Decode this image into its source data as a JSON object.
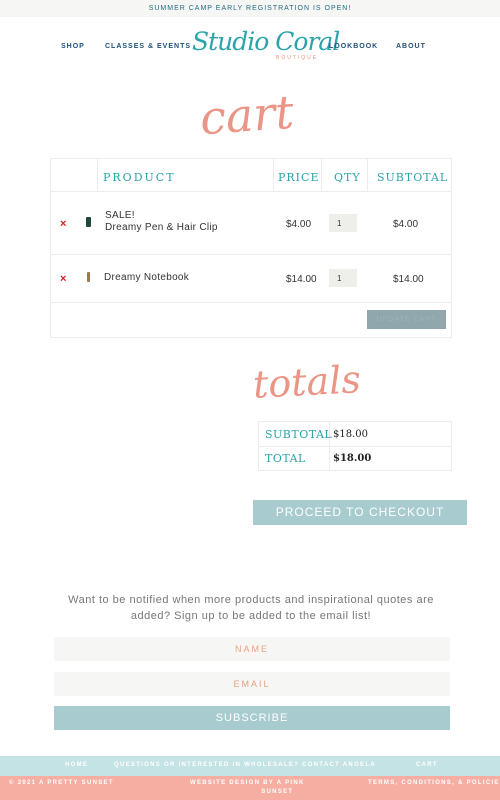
{
  "announcement": "SUMMER CAMP EARLY REGISTRATION IS OPEN!",
  "nav": {
    "shop": "SHOP",
    "classes": "CLASSES & EVENTS",
    "lookbook": "LOOKBOOK",
    "about": "ABOUT"
  },
  "logo": {
    "script": "Studio Coral",
    "subtitle": "BOUTIQUE"
  },
  "cart": {
    "title": "cart",
    "headers": {
      "product": "PRODUCT",
      "price": "PRICE",
      "qty": "QTY",
      "subtotal": "SUBTOTAL"
    },
    "items": [
      {
        "remove": "×",
        "name_line1": "SALE!",
        "name_line2": "Dreamy Pen & Hair Clip",
        "price": "$4.00",
        "qty": "1",
        "subtotal": "$4.00"
      },
      {
        "remove": "×",
        "name_line1": "Dreamy Notebook",
        "price": "$14.00",
        "qty": "1",
        "subtotal": "$14.00"
      }
    ],
    "update_label": "UPDATE CART"
  },
  "totals": {
    "title": "totals",
    "subtotal_label": "SUBTOTAL",
    "subtotal_value": "$18.00",
    "total_label": "TOTAL",
    "total_value": "$18.00",
    "checkout_label": "PROCEED TO CHECKOUT"
  },
  "signup": {
    "text": "Want to be notified when more products and inspirational quotes are added? Sign up to be added to the email list!",
    "name_placeholder": "NAME",
    "email_placeholder": "EMAIL",
    "subscribe_label": "SUBSCRIBE"
  },
  "footer": {
    "home": "HOME",
    "wholesale": "QUESTIONS OR INTERESTED IN WHOLESALE? CONTACT ANGELA",
    "cart": "CART",
    "copyright": "© 2021 A PRETTY SUNSET",
    "design_line1": "WEBSITE DESIGN BY A PINK",
    "design_line2": "SUNSET",
    "terms": "TERMS, CONDITIONS, & POLICIES"
  },
  "colors": {
    "teal": "#2aa3ab",
    "coral": "#ea9585",
    "button": "#a7cbcf",
    "remove": "#d41f1f"
  }
}
